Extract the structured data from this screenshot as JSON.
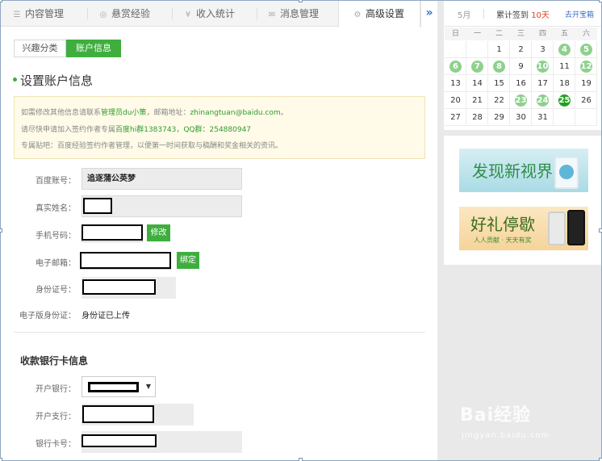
{
  "tabs": [
    {
      "label": "内容管理",
      "icon": "list-icon"
    },
    {
      "label": "悬赏经验",
      "icon": "coin-icon"
    },
    {
      "label": "收入统计",
      "icon": "yen-icon"
    },
    {
      "label": "消息管理",
      "icon": "envelope-icon"
    },
    {
      "label": "高级设置",
      "icon": "gear-icon",
      "active": true
    }
  ],
  "tab_more": "»",
  "subtabs": {
    "interest": "兴趣分类",
    "account": "账户信息"
  },
  "section_title": "设置账户信息",
  "notice": {
    "line1_a": "如需修改其他信息请联系",
    "line1_link": "管理员du小策",
    "line1_b": "，邮箱地址：",
    "line1_email": "zhinangtuan@baidu.com",
    "line1_c": "。",
    "line2_a": "请尽快申请加入签约作者专属",
    "line2_qun": "百度hi群1383743",
    "line2_b": "，",
    "line2_qq": "QQ群：254880947",
    "line3": "专属贴吧：百度经验签约作者管理，以便第一时间获取与稿酬和奖金相关的资讯。"
  },
  "form": {
    "baidu_account_label": "百度账号：",
    "baidu_account_value": "追逐蒲公英梦",
    "real_name_label": "真实姓名：",
    "phone_label": "手机号码：",
    "phone_btn": "修改",
    "email_label": "电子邮箱：",
    "email_btn": "绑定",
    "id_label": "身份证号：",
    "eid_label": "电子版身份证：",
    "eid_value": "身份证已上传"
  },
  "bank": {
    "title": "收款银行卡信息",
    "bank_label": "开户银行：",
    "branch_label": "开户支行：",
    "card_label": "银行卡号："
  },
  "calendar": {
    "month": "5月",
    "signin_label": "累计签到",
    "signin_days": "10天",
    "open_link": "去开宝箱",
    "weekdays": [
      "日",
      "一",
      "二",
      "三",
      "四",
      "五",
      "六"
    ],
    "days": [
      "",
      "",
      "1",
      "2",
      "3",
      "4",
      "5",
      "6",
      "7",
      "8",
      "9",
      "10",
      "11",
      "12",
      "13",
      "14",
      "15",
      "16",
      "17",
      "18",
      "19",
      "20",
      "21",
      "22",
      "23",
      "24",
      "25",
      "26",
      "27",
      "28",
      "29",
      "30",
      "31",
      "",
      ""
    ],
    "signed_days": [
      "4",
      "5",
      "6",
      "7",
      "8",
      "10",
      "12",
      "23",
      "24"
    ],
    "today": "25"
  },
  "ads": {
    "ad1_text": "发现新视界",
    "ad2_text": "好礼停歇",
    "ad2_sub": "人人贡献 · 天天有奖"
  },
  "watermark": {
    "logo": "Bai经验",
    "url": "jingyan.baidu.com"
  },
  "colors": {
    "accent_green": "#3fae3f",
    "signed_green": "#8ed08e",
    "today_green": "#23a123",
    "link_blue": "#3b6fc6",
    "highlight_red": "#e2421e"
  }
}
